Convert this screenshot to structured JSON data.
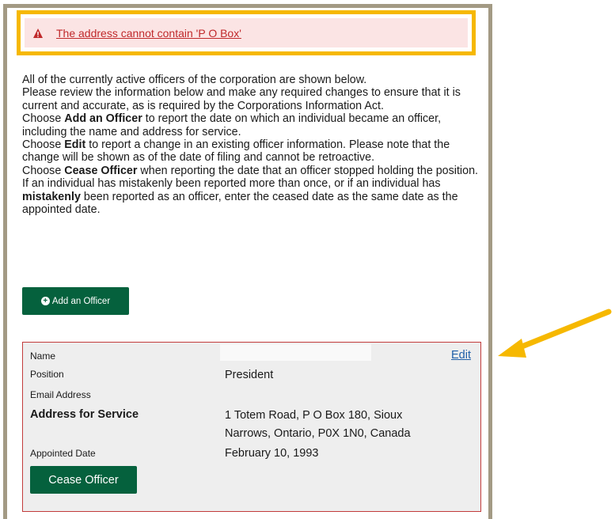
{
  "error": {
    "message": "The address cannot contain 'P O Box'",
    "icon": "warning-triangle-icon",
    "color": "#c0292b",
    "highlight_color": "#f6b800"
  },
  "intro": {
    "p1": "All of the currently active officers of the corporation are shown below.",
    "p2": "Please review the information below and make any required changes to ensure that it is current and accurate, as is required by the Corporations Information Act.",
    "p3_bold": "Add an Officer",
    "p3_pre": "Choose ",
    "p3_post": " to report the date on which an individual became an officer, including the name and address for service.",
    "p4_pre": "Choose ",
    "p4_bold": "Edit",
    "p4_post": " to report a change in an existing officer information. Please note that the change will be shown as of the date of filing and cannot be retroactive.",
    "p5_pre": "Choose ",
    "p5_bold": "Cease Officer",
    "p5_mid": " when reporting the date that an officer stopped holding the position. If an individual has mistakenly been reported more than once, or if an individual has ",
    "p5_bold2": "mistakenly",
    "p5_post": " been reported as an officer, enter the ceased date as the same date as the appointed date."
  },
  "add_officer_button": {
    "label": "Add an Officer",
    "icon": "plus-circle-icon"
  },
  "officer": {
    "labels": {
      "name": "Name",
      "position": "Position",
      "email": "Email Address",
      "address": "Address for Service",
      "appointed": "Appointed Date"
    },
    "values": {
      "position": "President",
      "address_line1": "1 Totem Road, P O Box 180, Sioux",
      "address_line2": "Narrows, Ontario, P0X 1N0, Canada",
      "appointed": "February 10, 1993"
    },
    "edit_label": "Edit",
    "cease_label": "Cease Officer"
  },
  "colors": {
    "button_green": "#05613d",
    "card_border": "#c23b3b",
    "frame_border": "#a39a84",
    "arrow": "#f6b800"
  }
}
